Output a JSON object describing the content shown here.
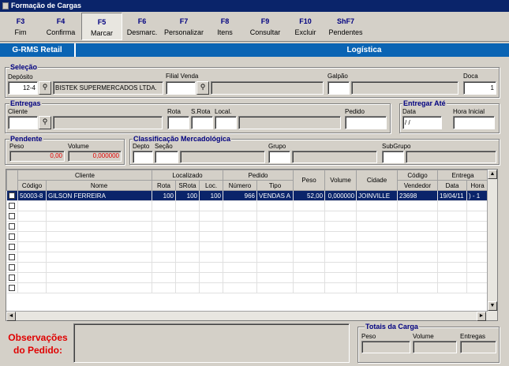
{
  "window": {
    "title": "Formação de Cargas"
  },
  "toolbar": [
    {
      "key": "F3",
      "label": "Fim"
    },
    {
      "key": "F4",
      "label": "Confirma"
    },
    {
      "key": "F5",
      "label": "Marcar"
    },
    {
      "key": "F6",
      "label": "Desmarc."
    },
    {
      "key": "F7",
      "label": "Personalizar"
    },
    {
      "key": "F8",
      "label": "Itens"
    },
    {
      "key": "F9",
      "label": "Consultar"
    },
    {
      "key": "F10",
      "label": "Excluir"
    },
    {
      "key": "ShF7",
      "label": "Pendentes"
    }
  ],
  "brand": {
    "left": "G-RMS Retail",
    "right": "Logística"
  },
  "selecao": {
    "title": "Seleção",
    "deposito_label": "Depósito",
    "deposito": "12-4",
    "deposito_nome": "BISTEK SUPERMERCADOS LTDA.",
    "filial_label": "Filial Venda",
    "filial": "",
    "filial_nome": "",
    "galpao_label": "Galpão",
    "galpao": "",
    "galpao_nome": "",
    "doca_label": "Doca",
    "doca": "1"
  },
  "entregas": {
    "title": "Entregas",
    "cliente_label": "Cliente",
    "cliente": "",
    "cliente_nome": "",
    "rota_label": "Rota",
    "rota": "",
    "srota_label": "S.Rota",
    "srota": "",
    "local_label": "Local.",
    "local": "",
    "local_nome": "",
    "pedido_label": "Pedido",
    "pedido": ""
  },
  "entregar_ate": {
    "title": "Entregar Até",
    "data_label": "Data",
    "data": " / /",
    "hora_label": "Hora Inicial",
    "hora": ""
  },
  "pendente": {
    "title": "Pendente",
    "peso_label": "Peso",
    "peso": "0,00",
    "volume_label": "Volume",
    "volume": "0,000000"
  },
  "classificacao": {
    "title": "Classificação Mercadológica",
    "depto_label": "Depto",
    "secao_label": "Seção",
    "grupo_label": "Grupo",
    "subgrupo_label": "SubGrupo"
  },
  "grid": {
    "group_headers": {
      "cliente": "Cliente",
      "localizado": "Localizado",
      "pedido": "Pedido",
      "peso": "Peso",
      "volume": "Volume",
      "cidade": "Cidade",
      "codigo": "Código",
      "entrega": "Entrega"
    },
    "headers": {
      "codigo": "Código",
      "nome": "Nome",
      "rota": "Rota",
      "srota": "SRota",
      "loc": "Loc.",
      "numero": "Número",
      "tipo": "Tipo",
      "vendedor": "Vendedor",
      "data": "Data",
      "hora": "Hora"
    },
    "rows": [
      {
        "codigo": "50003-8",
        "nome": "GILSON FERREIRA",
        "rota": "100",
        "srota": "100",
        "loc": "100",
        "numero": "966",
        "tipo": "VENDAS A",
        "peso": "52,00",
        "volume": "0,000000",
        "cidade": "JOINVILLE",
        "vendedor": "23698",
        "data": "19/04/11",
        "hora": ") - 1"
      }
    ]
  },
  "observacoes": {
    "label": "Observações do Pedido:",
    "text": ""
  },
  "totais": {
    "title": "Totais da Carga",
    "peso_label": "Peso",
    "volume_label": "Volume",
    "entregas_label": "Entregas",
    "peso": "",
    "volume": "",
    "entregas": ""
  }
}
